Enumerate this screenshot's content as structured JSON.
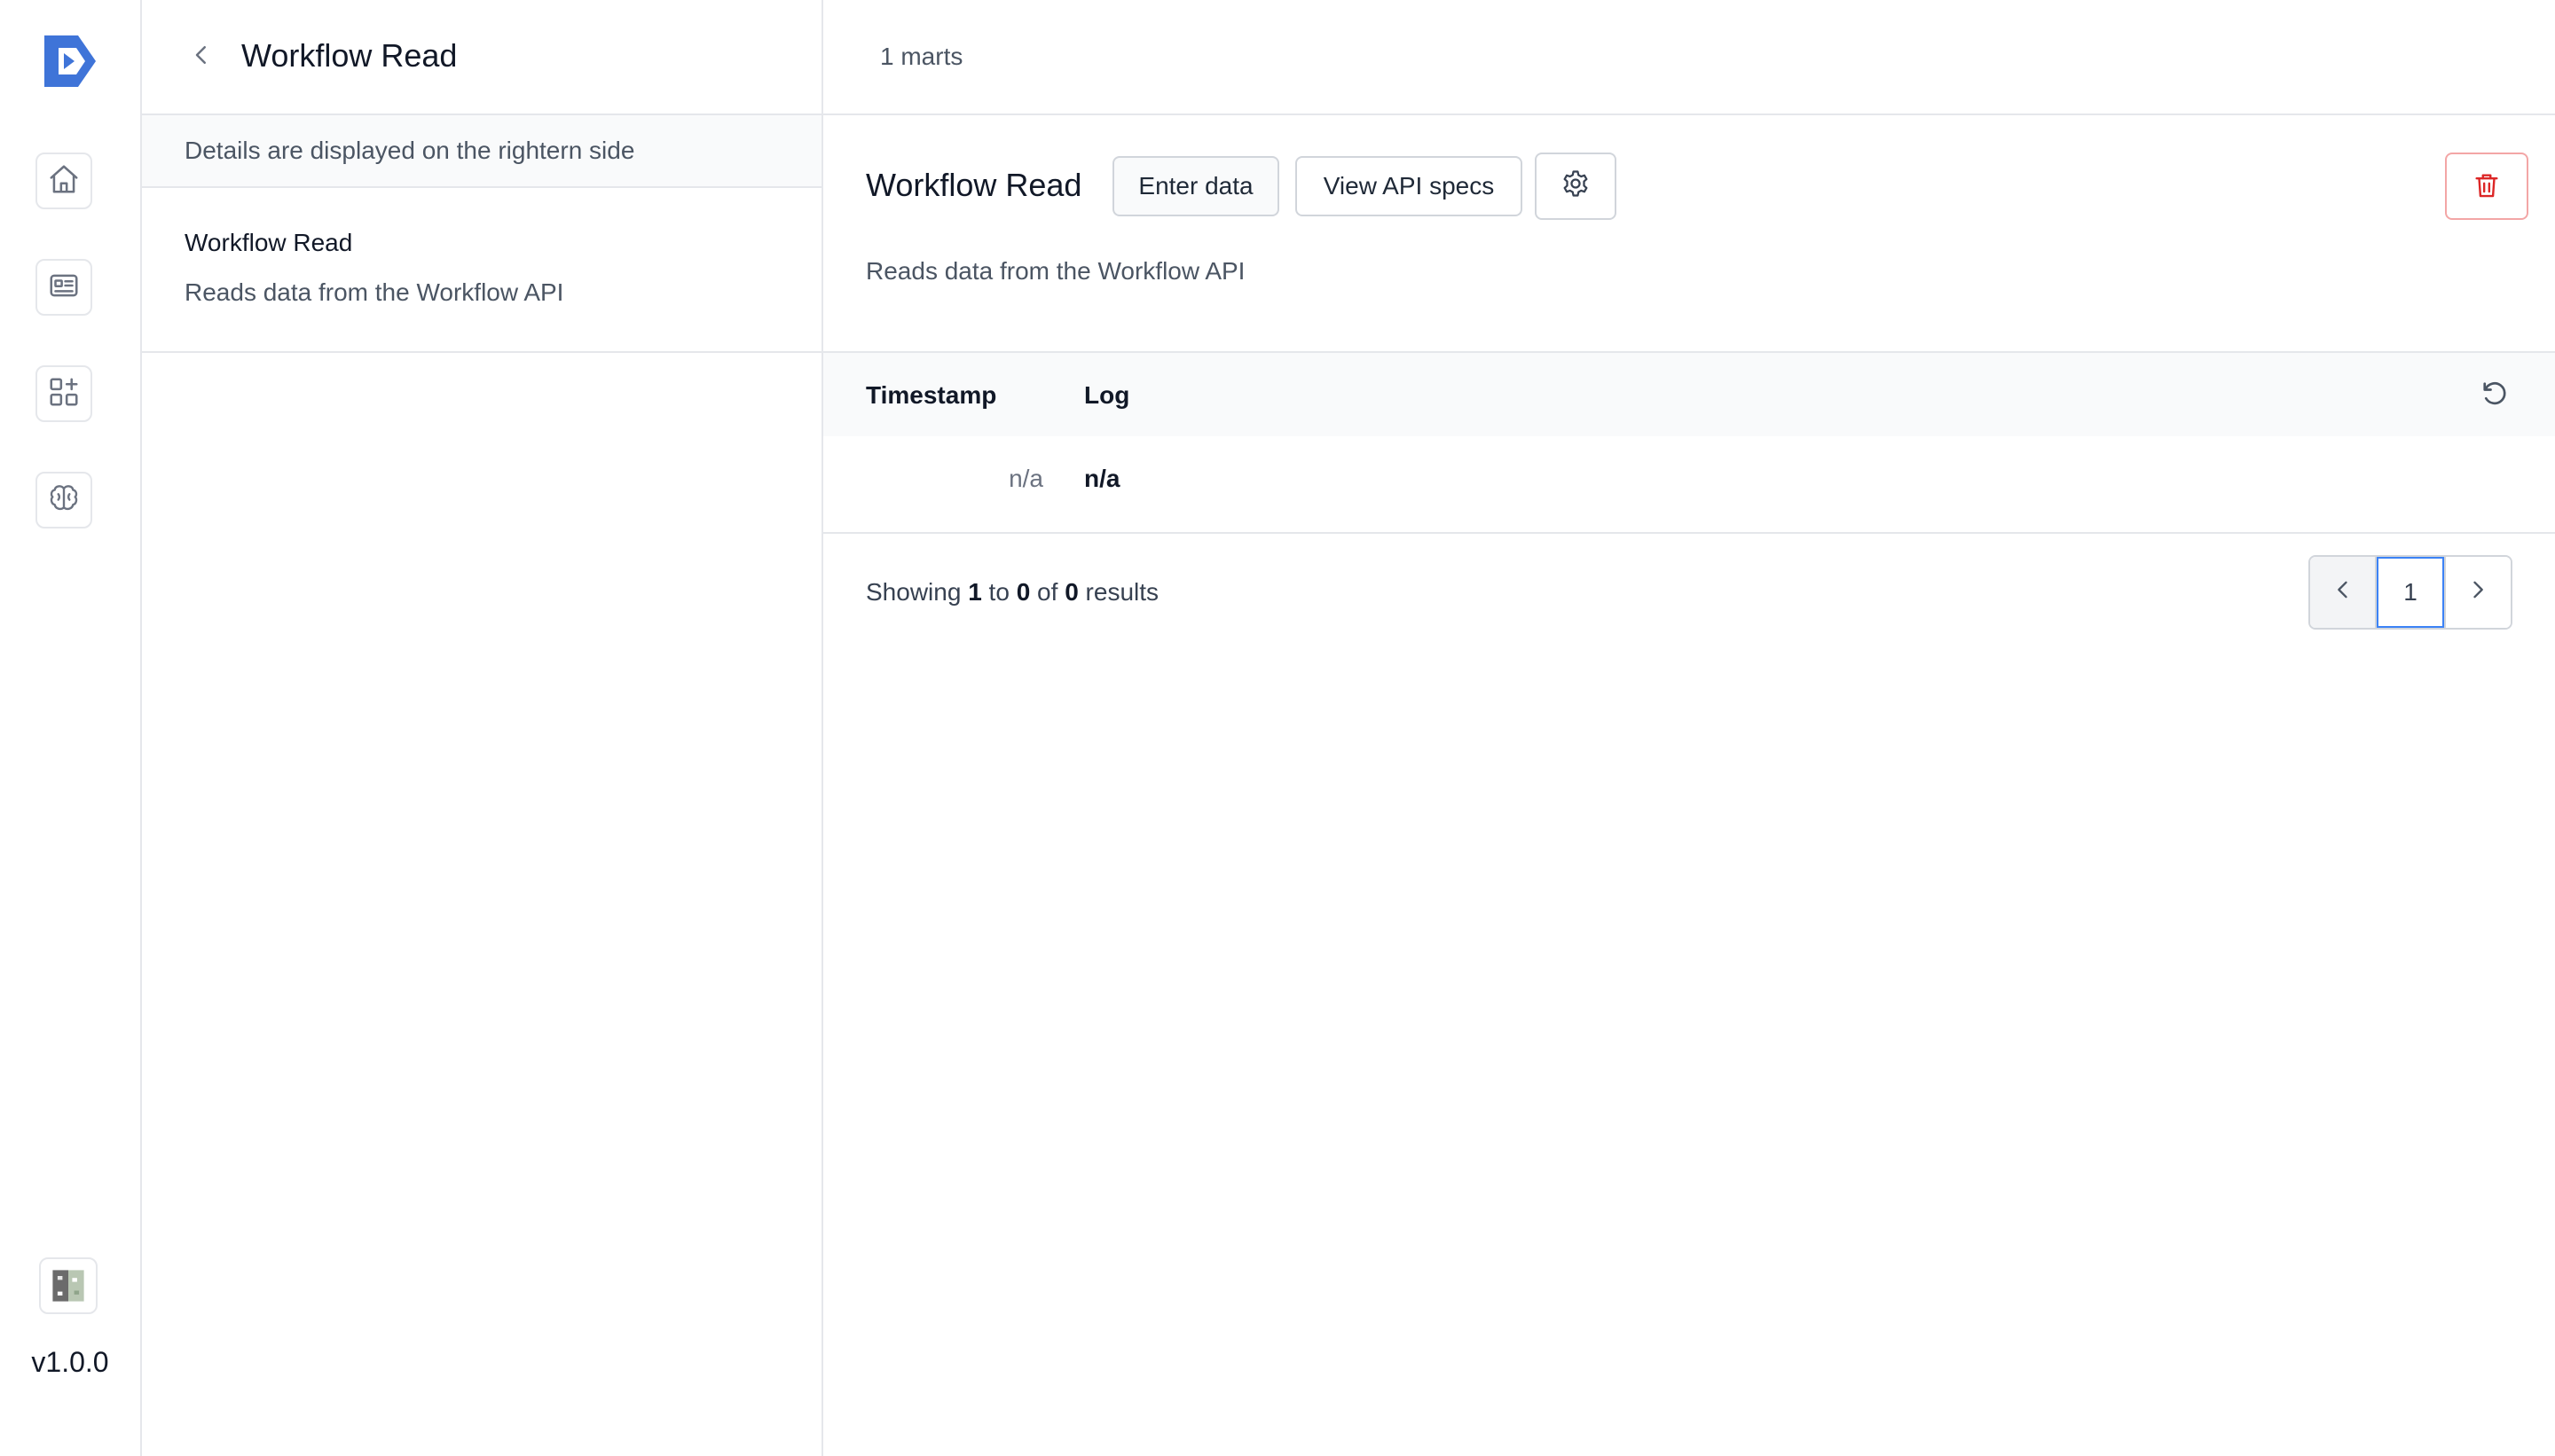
{
  "rail": {
    "items": [
      {
        "icon": "home-icon"
      },
      {
        "icon": "id-card-icon"
      },
      {
        "icon": "apps-add-icon"
      },
      {
        "icon": "brain-icon"
      }
    ],
    "version": "v1.0.0"
  },
  "middle": {
    "title": "Workflow Read",
    "info": "Details are displayed on the rightern side",
    "item": {
      "title": "Workflow Read",
      "description": "Reads data from the Workflow API"
    }
  },
  "main": {
    "marts_count": "1 marts",
    "detail": {
      "title": "Workflow Read",
      "description": "Reads data from the Workflow API",
      "buttons": {
        "enter_data": "Enter data",
        "view_api": "View API specs"
      }
    },
    "table": {
      "columns": [
        "Timestamp",
        "Log"
      ],
      "rows": [
        {
          "timestamp": "n/a",
          "log": "n/a"
        }
      ]
    },
    "results": {
      "prefix": "Showing",
      "from": "1",
      "to_word": "to",
      "to": "0",
      "of_word": "of",
      "total": "0",
      "suffix": "results"
    },
    "pagination": {
      "current_page": "1"
    }
  },
  "colors": {
    "accent": "#3b82f6",
    "logo": "#3f74d8",
    "danger": "#dc2626",
    "border": "#e5e7eb"
  }
}
